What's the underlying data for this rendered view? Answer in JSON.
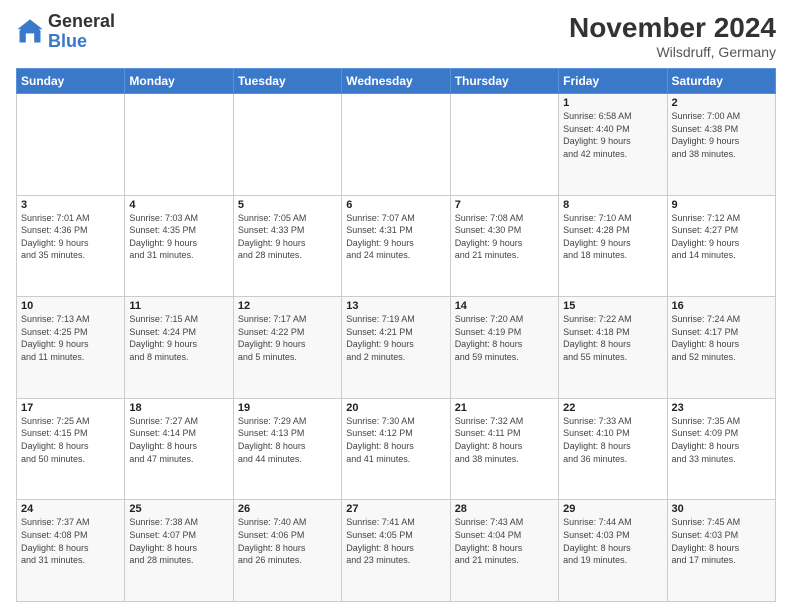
{
  "logo": {
    "text_general": "General",
    "text_blue": "Blue"
  },
  "header": {
    "month": "November 2024",
    "location": "Wilsdruff, Germany"
  },
  "days_of_week": [
    "Sunday",
    "Monday",
    "Tuesday",
    "Wednesday",
    "Thursday",
    "Friday",
    "Saturday"
  ],
  "weeks": [
    [
      {
        "day": "",
        "info": ""
      },
      {
        "day": "",
        "info": ""
      },
      {
        "day": "",
        "info": ""
      },
      {
        "day": "",
        "info": ""
      },
      {
        "day": "",
        "info": ""
      },
      {
        "day": "1",
        "info": "Sunrise: 6:58 AM\nSunset: 4:40 PM\nDaylight: 9 hours\nand 42 minutes."
      },
      {
        "day": "2",
        "info": "Sunrise: 7:00 AM\nSunset: 4:38 PM\nDaylight: 9 hours\nand 38 minutes."
      }
    ],
    [
      {
        "day": "3",
        "info": "Sunrise: 7:01 AM\nSunset: 4:36 PM\nDaylight: 9 hours\nand 35 minutes."
      },
      {
        "day": "4",
        "info": "Sunrise: 7:03 AM\nSunset: 4:35 PM\nDaylight: 9 hours\nand 31 minutes."
      },
      {
        "day": "5",
        "info": "Sunrise: 7:05 AM\nSunset: 4:33 PM\nDaylight: 9 hours\nand 28 minutes."
      },
      {
        "day": "6",
        "info": "Sunrise: 7:07 AM\nSunset: 4:31 PM\nDaylight: 9 hours\nand 24 minutes."
      },
      {
        "day": "7",
        "info": "Sunrise: 7:08 AM\nSunset: 4:30 PM\nDaylight: 9 hours\nand 21 minutes."
      },
      {
        "day": "8",
        "info": "Sunrise: 7:10 AM\nSunset: 4:28 PM\nDaylight: 9 hours\nand 18 minutes."
      },
      {
        "day": "9",
        "info": "Sunrise: 7:12 AM\nSunset: 4:27 PM\nDaylight: 9 hours\nand 14 minutes."
      }
    ],
    [
      {
        "day": "10",
        "info": "Sunrise: 7:13 AM\nSunset: 4:25 PM\nDaylight: 9 hours\nand 11 minutes."
      },
      {
        "day": "11",
        "info": "Sunrise: 7:15 AM\nSunset: 4:24 PM\nDaylight: 9 hours\nand 8 minutes."
      },
      {
        "day": "12",
        "info": "Sunrise: 7:17 AM\nSunset: 4:22 PM\nDaylight: 9 hours\nand 5 minutes."
      },
      {
        "day": "13",
        "info": "Sunrise: 7:19 AM\nSunset: 4:21 PM\nDaylight: 9 hours\nand 2 minutes."
      },
      {
        "day": "14",
        "info": "Sunrise: 7:20 AM\nSunset: 4:19 PM\nDaylight: 8 hours\nand 59 minutes."
      },
      {
        "day": "15",
        "info": "Sunrise: 7:22 AM\nSunset: 4:18 PM\nDaylight: 8 hours\nand 55 minutes."
      },
      {
        "day": "16",
        "info": "Sunrise: 7:24 AM\nSunset: 4:17 PM\nDaylight: 8 hours\nand 52 minutes."
      }
    ],
    [
      {
        "day": "17",
        "info": "Sunrise: 7:25 AM\nSunset: 4:15 PM\nDaylight: 8 hours\nand 50 minutes."
      },
      {
        "day": "18",
        "info": "Sunrise: 7:27 AM\nSunset: 4:14 PM\nDaylight: 8 hours\nand 47 minutes."
      },
      {
        "day": "19",
        "info": "Sunrise: 7:29 AM\nSunset: 4:13 PM\nDaylight: 8 hours\nand 44 minutes."
      },
      {
        "day": "20",
        "info": "Sunrise: 7:30 AM\nSunset: 4:12 PM\nDaylight: 8 hours\nand 41 minutes."
      },
      {
        "day": "21",
        "info": "Sunrise: 7:32 AM\nSunset: 4:11 PM\nDaylight: 8 hours\nand 38 minutes."
      },
      {
        "day": "22",
        "info": "Sunrise: 7:33 AM\nSunset: 4:10 PM\nDaylight: 8 hours\nand 36 minutes."
      },
      {
        "day": "23",
        "info": "Sunrise: 7:35 AM\nSunset: 4:09 PM\nDaylight: 8 hours\nand 33 minutes."
      }
    ],
    [
      {
        "day": "24",
        "info": "Sunrise: 7:37 AM\nSunset: 4:08 PM\nDaylight: 8 hours\nand 31 minutes."
      },
      {
        "day": "25",
        "info": "Sunrise: 7:38 AM\nSunset: 4:07 PM\nDaylight: 8 hours\nand 28 minutes."
      },
      {
        "day": "26",
        "info": "Sunrise: 7:40 AM\nSunset: 4:06 PM\nDaylight: 8 hours\nand 26 minutes."
      },
      {
        "day": "27",
        "info": "Sunrise: 7:41 AM\nSunset: 4:05 PM\nDaylight: 8 hours\nand 23 minutes."
      },
      {
        "day": "28",
        "info": "Sunrise: 7:43 AM\nSunset: 4:04 PM\nDaylight: 8 hours\nand 21 minutes."
      },
      {
        "day": "29",
        "info": "Sunrise: 7:44 AM\nSunset: 4:03 PM\nDaylight: 8 hours\nand 19 minutes."
      },
      {
        "day": "30",
        "info": "Sunrise: 7:45 AM\nSunset: 4:03 PM\nDaylight: 8 hours\nand 17 minutes."
      }
    ]
  ]
}
